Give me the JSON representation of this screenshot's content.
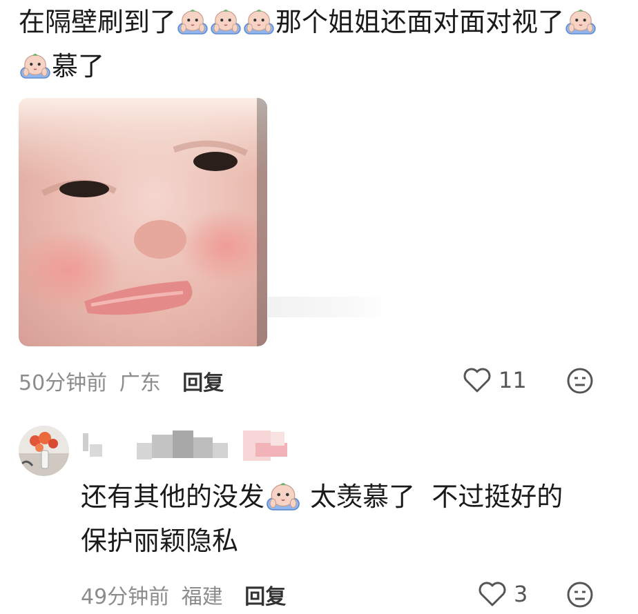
{
  "comments": [
    {
      "text_parts": [
        "在隔壁刷到了",
        "那个姐姐还面对面对视了",
        "慕了"
      ],
      "emoji": "crying-baby-emoji",
      "time": "50分钟前",
      "location": "广东",
      "reply_label": "回复",
      "likes": "11"
    },
    {
      "text_parts": [
        "还有其他的没发",
        " 太羡慕了  不过挺好的  保护丽颖隐私"
      ],
      "emoji": "crying-baby-emoji",
      "time": "49分钟前",
      "location": "福建",
      "reply_label": "回复",
      "likes": "3"
    }
  ],
  "icons": {
    "like": "heart-outline-icon",
    "react": "neutral-face-icon"
  },
  "colors": {
    "meta_text": "#8c8c8c",
    "emoji_blue": "#8fb6f0",
    "emoji_face": "#f6d3c4"
  }
}
